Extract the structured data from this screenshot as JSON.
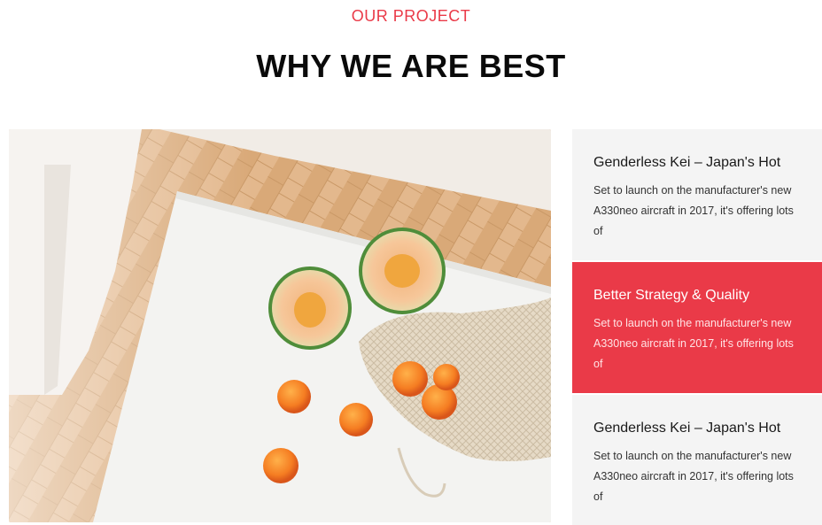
{
  "section": {
    "eyebrow": "OUR PROJECT",
    "title": "WHY WE ARE BEST"
  },
  "cards": [
    {
      "title": "Genderless Kei – Japan's Hot",
      "text": "Set to launch on the manufacturer's new A330neo aircraft in 2017, it's offering lots of",
      "active": false
    },
    {
      "title": "Better Strategy & Quality",
      "text": "Set to launch on the manufacturer's new A330neo aircraft in 2017, it's offering lots of",
      "active": true
    },
    {
      "title": "Genderless Kei – Japan's Hot",
      "text": "Set to launch on the manufacturer's new A330neo aircraft in 2017, it's offering lots of",
      "active": false
    }
  ],
  "colors": {
    "accent": "#ea3a48",
    "card_bg": "#f4f4f4",
    "heading": "#0a0a0a"
  }
}
